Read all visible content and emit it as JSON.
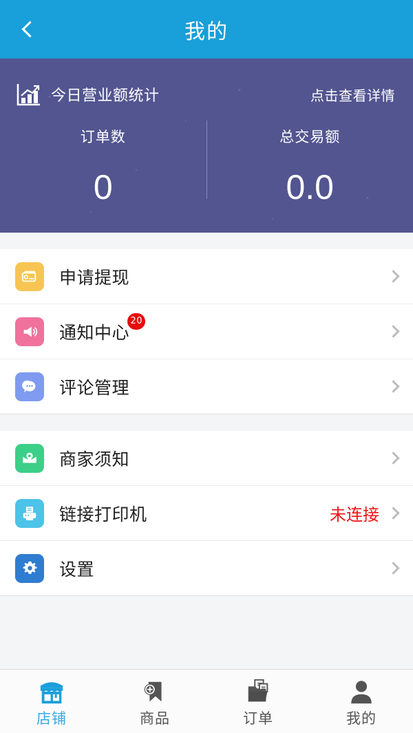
{
  "header": {
    "title": "我的",
    "back_icon": "chevron-left-icon",
    "background_color": "#199FD9"
  },
  "stats_panel": {
    "background_color": "#535590",
    "icon": "bar-chart-icon",
    "title": "今日营业额统计",
    "detail_link": "点击查看详情",
    "columns": [
      {
        "label": "订单数",
        "value": "0"
      },
      {
        "label": "总交易额",
        "value": "0.0"
      }
    ]
  },
  "menu_groups": [
    {
      "rows": [
        {
          "label": "申请提现",
          "icon": "credit-card-icon",
          "icon_color": "#F7C552",
          "chevron": "chevron-right-icon",
          "badge": null,
          "status": null
        },
        {
          "label": "通知中心",
          "icon": "megaphone-icon",
          "icon_color": "#F0729C",
          "chevron": "chevron-right-icon",
          "badge": "20",
          "status": null
        },
        {
          "label": "评论管理",
          "icon": "chat-bubble-icon",
          "icon_color": "#7E9BEF",
          "chevron": "chevron-right-icon",
          "badge": null,
          "status": null
        }
      ]
    },
    {
      "rows": [
        {
          "label": "商家须知",
          "icon": "envelope-icon",
          "icon_color": "#3CCF87",
          "chevron": "chevron-right-icon",
          "badge": null,
          "status": null
        },
        {
          "label": "链接打印机",
          "icon": "printer-icon",
          "icon_color": "#4CC3E8",
          "chevron": "chevron-right-icon",
          "badge": null,
          "status": "未连接",
          "status_color": "#F01414"
        },
        {
          "label": "设置",
          "icon": "gear-icon",
          "icon_color": "#2F7DD1",
          "chevron": "chevron-right-icon",
          "badge": null,
          "status": null
        }
      ]
    }
  ],
  "tabbar": {
    "active_color": "#3AA9E0",
    "inactive_color": "#555555",
    "tabs": [
      {
        "label": "店铺",
        "icon": "storefront-icon",
        "active": true
      },
      {
        "label": "商品",
        "icon": "product-tag-icon",
        "active": false
      },
      {
        "label": "订单",
        "icon": "order-folder-icon",
        "active": false
      },
      {
        "label": "我的",
        "icon": "person-icon",
        "active": false
      }
    ]
  }
}
